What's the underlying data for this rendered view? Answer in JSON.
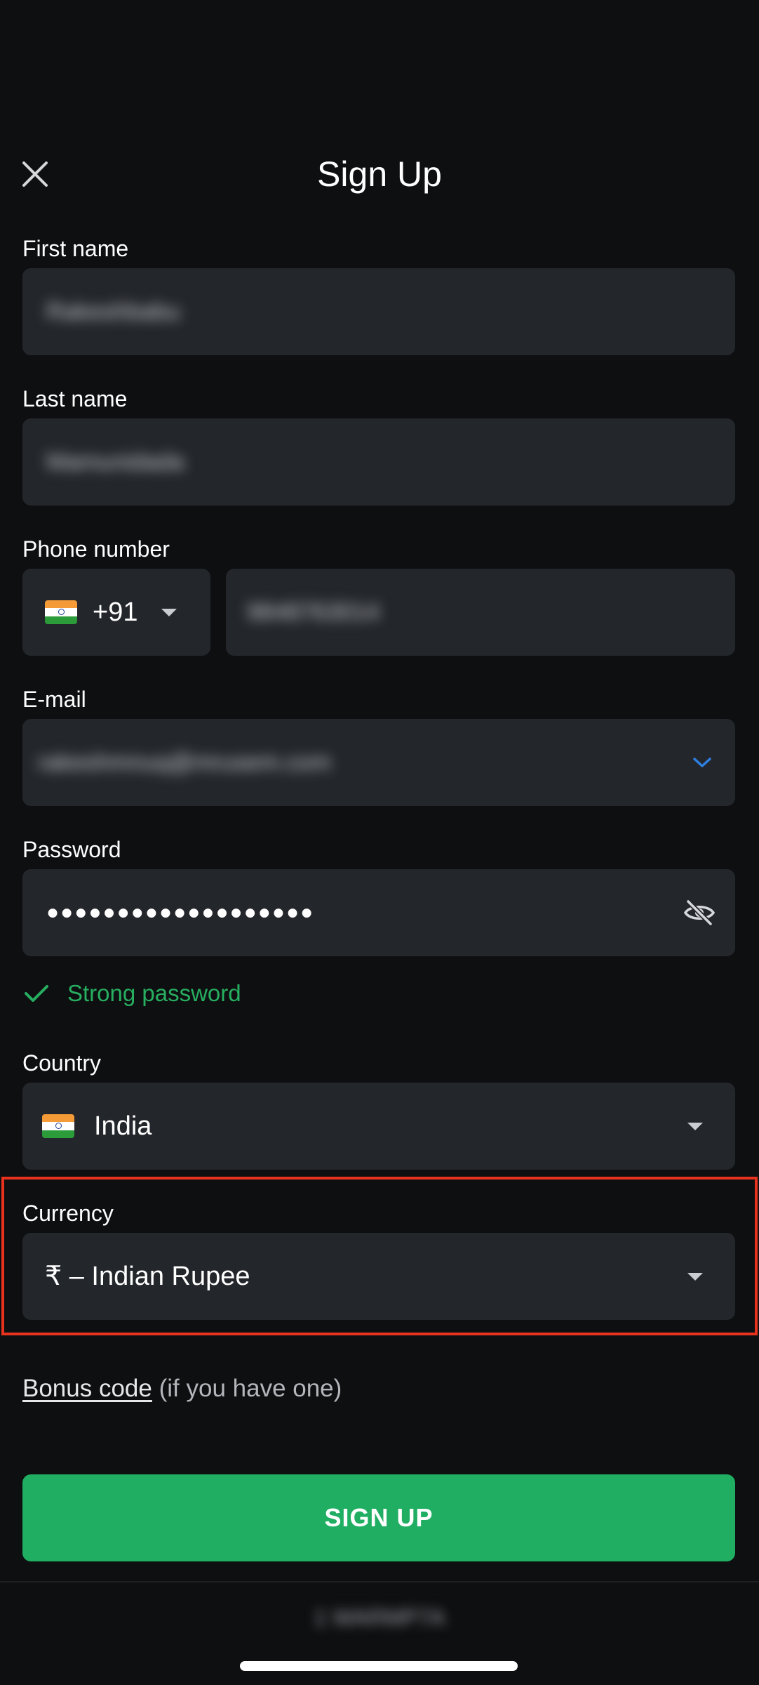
{
  "header": {
    "title": "Sign Up",
    "close_icon": "close-icon"
  },
  "form": {
    "first_name": {
      "label": "First name",
      "value": "Rakeshbabu"
    },
    "last_name": {
      "label": "Last name",
      "value": "Mamunidada"
    },
    "phone": {
      "label": "Phone number",
      "country_code": "+91",
      "value": "9848763014"
    },
    "email": {
      "label": "E-mail",
      "value": "rakeshmnuq@mrusem.com"
    },
    "password": {
      "label": "Password",
      "masked_value": "●●●●●●●●●●●●●●●●●●●",
      "strength_text": "Strong password",
      "strength_color": "#27ae60"
    },
    "country": {
      "label": "Country",
      "value": "India"
    },
    "currency": {
      "label": "Currency",
      "value": "₹ – Indian Rupee"
    }
  },
  "bonus": {
    "link_text": "Bonus code",
    "hint": " (if you have one)"
  },
  "signup_button": {
    "label": "SIGN UP",
    "color": "#1fae62"
  },
  "footer": {
    "blurred_text": "1 WARMP7A"
  },
  "colors": {
    "background": "#0e0f11",
    "field": "#23262b",
    "highlight": "#e8321e",
    "accent_blue": "#2d7fe0"
  }
}
